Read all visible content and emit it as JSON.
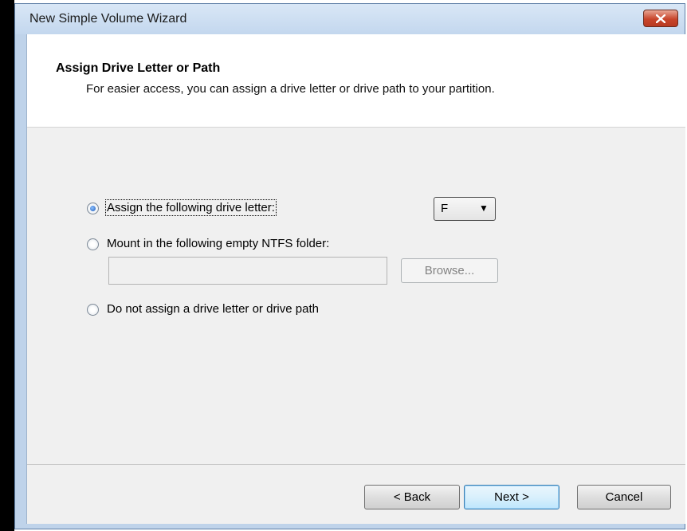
{
  "window": {
    "title": "New Simple Volume Wizard"
  },
  "header": {
    "title": "Assign Drive Letter or Path",
    "subtitle": "For easier access, you can assign a drive letter or drive path to your partition."
  },
  "options": {
    "assign_letter": {
      "label": "Assign the following drive letter:",
      "selected": true
    },
    "mount_folder": {
      "label": "Mount in the following empty NTFS folder:",
      "selected": false
    },
    "no_assign": {
      "label": "Do not assign a drive letter or drive path",
      "selected": false
    }
  },
  "drive_letter": {
    "value": "F"
  },
  "folder_path": {
    "value": ""
  },
  "buttons": {
    "browse": "Browse...",
    "back": "< Back",
    "next": "Next >",
    "cancel": "Cancel"
  },
  "icons": {
    "close": "close-icon",
    "dropdown": "chevron-down-icon"
  },
  "colors": {
    "titlebar": "#c3d7ee",
    "close_button": "#c8452b",
    "dialog_bg": "#f0f0f0"
  }
}
